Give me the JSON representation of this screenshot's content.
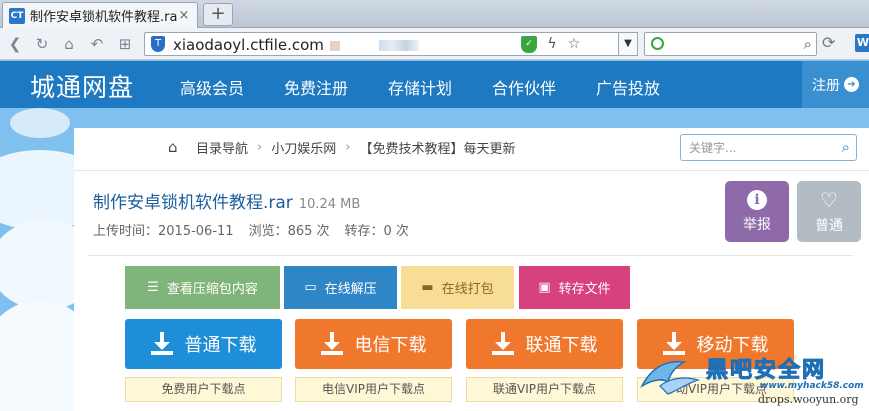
{
  "browser": {
    "tab_title": "制作安卓锁机软件教程.rar",
    "tab_favicon": "CT",
    "tab_close": "×",
    "new_tab": "+",
    "url": "xiaodaoyl.ctfile.com",
    "url_shield_badge": "T",
    "toolbar_end_badge": "W"
  },
  "header": {
    "logo": "城通网盘",
    "nav": [
      "高级会员",
      "免费注册",
      "存储计划",
      "合作伙伴",
      "广告投放"
    ],
    "register_label": "注册",
    "register_arrow": "➔"
  },
  "breadcrumb": {
    "home": "目录导航",
    "sep": "›",
    "level2": "小刀娱乐网",
    "level3": "【免费技术教程】每天更新"
  },
  "search": {
    "placeholder": "关键字..."
  },
  "file": {
    "name": "制作安卓锁机软件教程.rar",
    "size": "10.24 MB",
    "upload_time": "上传时间：2015-06-11",
    "views": "浏览：865 次",
    "saves": "转存：0 次"
  },
  "side_buttons": {
    "report_label": "举报",
    "report_icon_char": "i",
    "normal_label": "普通",
    "normal_icon_char": "♡"
  },
  "actions": {
    "view_archive": "查看压缩包内容",
    "view_archive_icon": "☰",
    "online_unzip": "在线解压",
    "online_unzip_icon": "▭",
    "online_pack": "在线打包",
    "online_pack_icon": "▬",
    "save_file": "转存文件",
    "save_file_icon": "▣"
  },
  "downloads": [
    {
      "label": "普通下载",
      "note": "免费用户下载点"
    },
    {
      "label": "电信下载",
      "note": "电信VIP用户下载点"
    },
    {
      "label": "联通下载",
      "note": "联通VIP用户下载点"
    },
    {
      "label": "移动下载",
      "note": "移动VIP用户下载点"
    }
  ],
  "watermark": {
    "title": "黑吧安全网",
    "sub": "www.myhack58.com",
    "drops": "drops.wooyun.org"
  },
  "colors": {
    "header_bg": "#1c79c2",
    "download_normal": "#1f8ed8",
    "download_vip": "#f0782c",
    "view_archive": "#7fb57b",
    "online_unzip": "#2f86c6",
    "online_pack": "#f8dd95",
    "save_file": "#d7417e",
    "report": "#8e6aa9",
    "normal": "#b3bcc3"
  }
}
